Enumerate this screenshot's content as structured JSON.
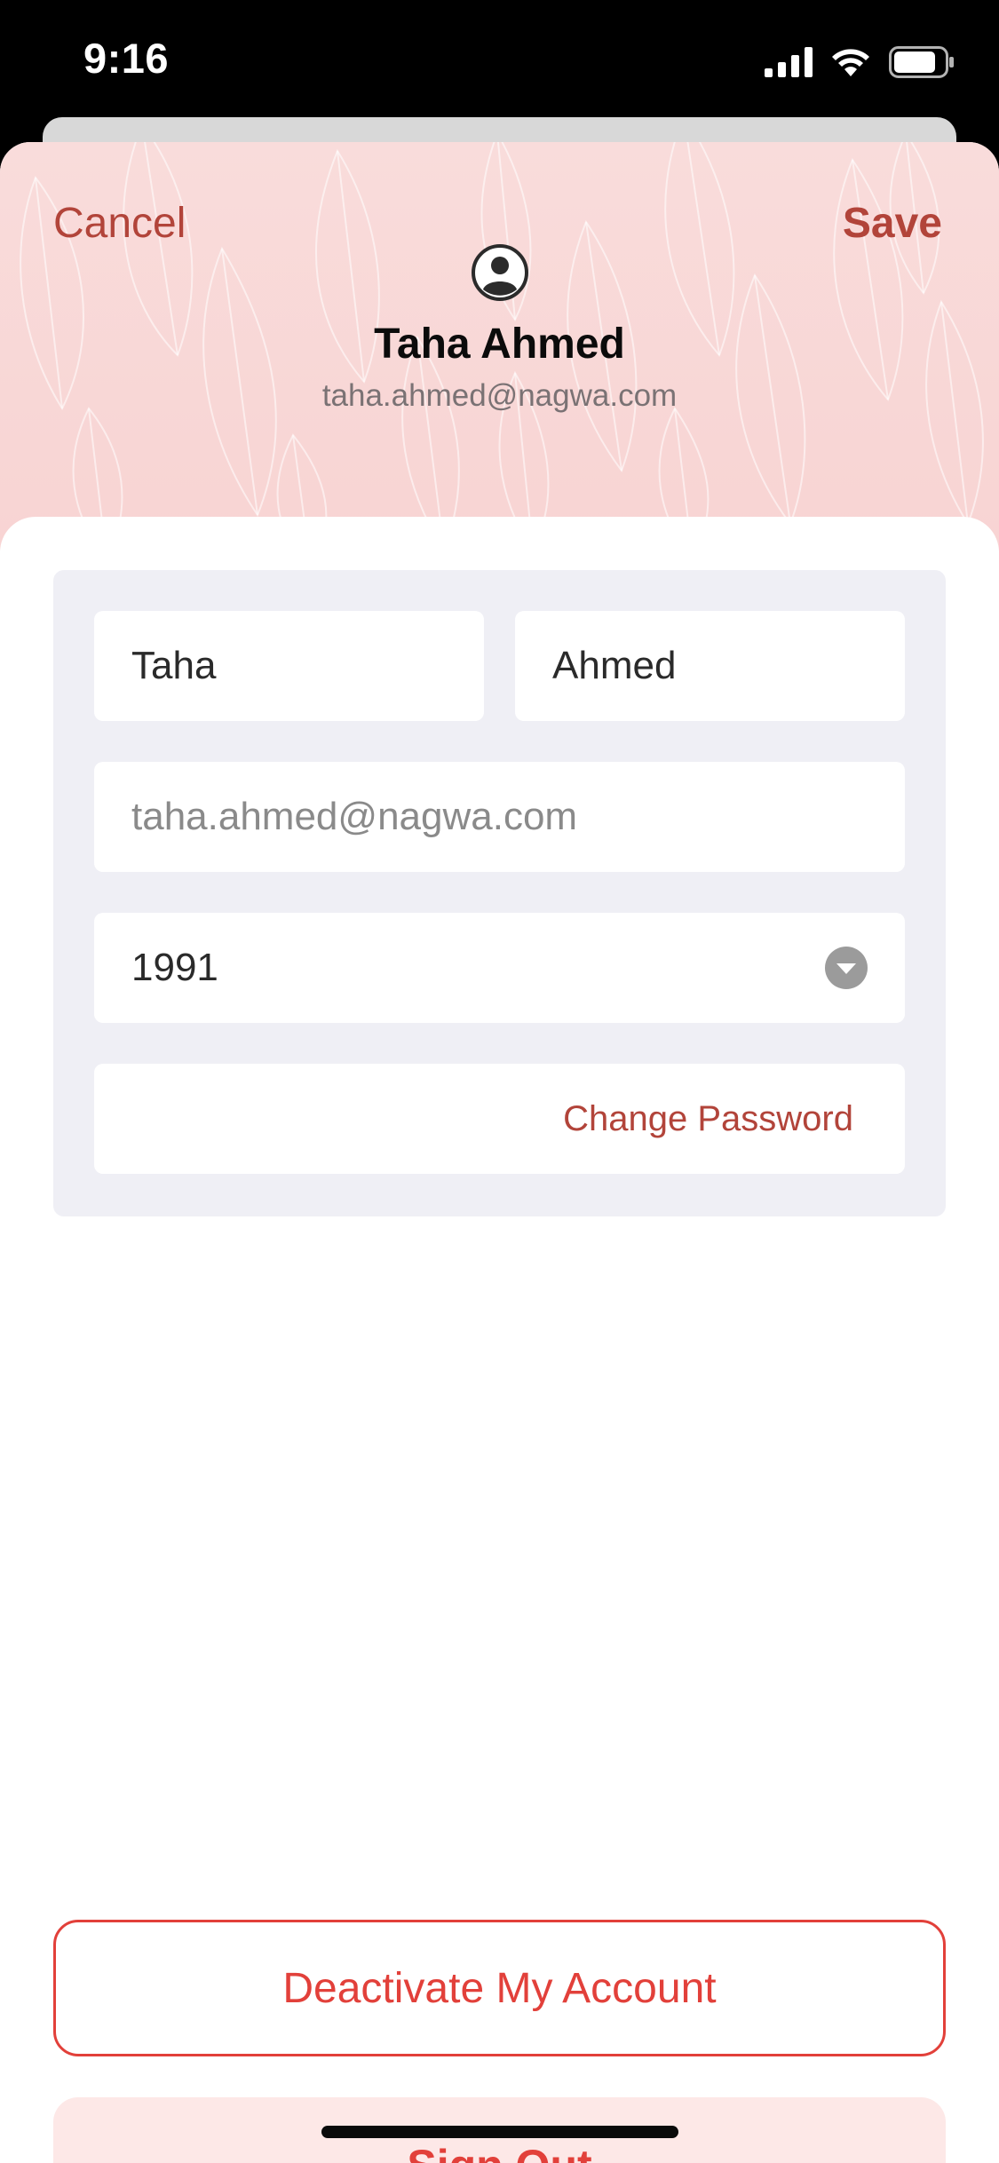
{
  "status_bar": {
    "time": "9:16",
    "icons": [
      "cellular-signal-icon",
      "wifi-icon",
      "battery-icon"
    ]
  },
  "header": {
    "cancel_label": "Cancel",
    "save_label": "Save",
    "avatar_icon": "person-circle-icon",
    "name": "Taha Ahmed",
    "email": "taha.ahmed@nagwa.com"
  },
  "form": {
    "first_name": "Taha",
    "last_name": "Ahmed",
    "email": "taha.ahmed@nagwa.com",
    "birth_year": "1991",
    "birth_year_icon": "chevron-down-circle-icon",
    "change_password_label": "Change Password"
  },
  "actions": {
    "deactivate_label": "Deactivate My Account",
    "sign_out_label": "Sign Out"
  },
  "colors": {
    "accent": "#b2443a",
    "danger": "#e2403a",
    "header_bg": "#f9dcdb",
    "form_bg": "#efeff5",
    "sign_out_bg": "#fde8e7"
  }
}
